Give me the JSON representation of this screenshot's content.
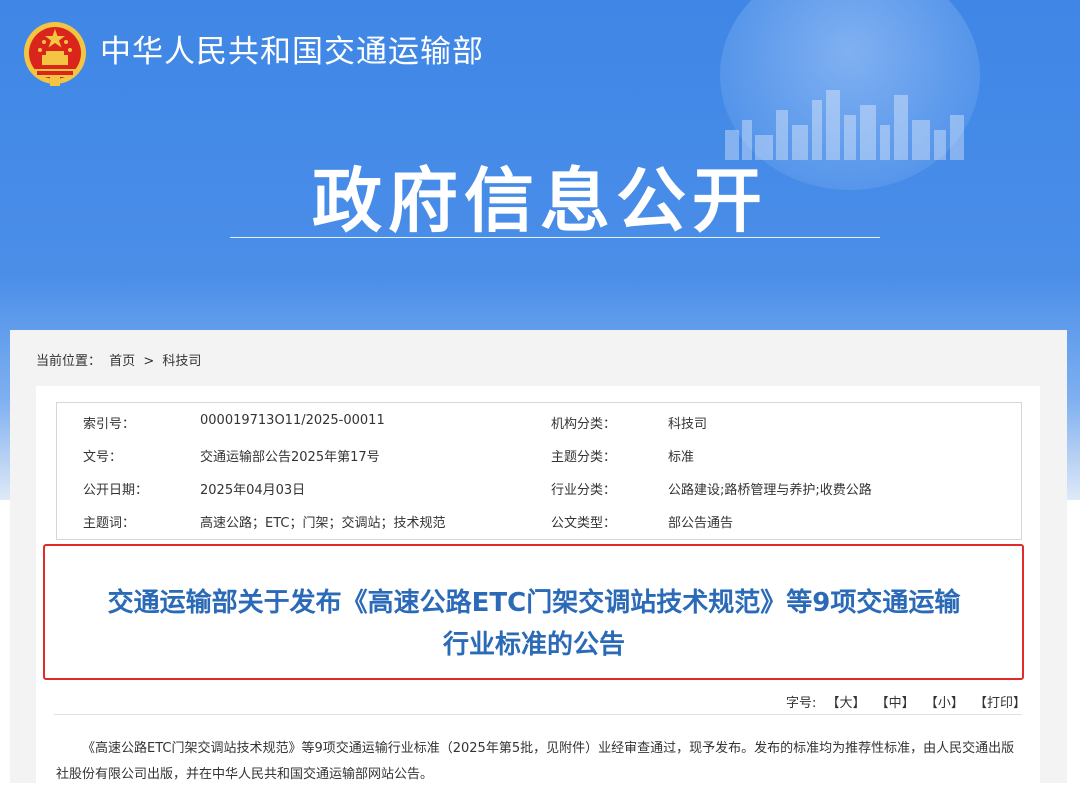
{
  "header": {
    "site_name": "中华人民共和国交通运输部",
    "hero_title": "政府信息公开"
  },
  "breadcrumb": {
    "label": "当前位置：",
    "home": "首页",
    "separator": ">",
    "current": "科技司"
  },
  "meta": {
    "rows": [
      {
        "k1": "索引号：",
        "v1": "000019713O11/2025-00011",
        "k2": "机构分类：",
        "v2": "科技司"
      },
      {
        "k1": "文号：",
        "v1": "交通运输部公告2025年第17号",
        "k2": "主题分类：",
        "v2": "标准"
      },
      {
        "k1": "公开日期：",
        "v1": "2025年04月03日",
        "k2": "行业分类：",
        "v2": "公路建设;路桥管理与养护;收费公路"
      },
      {
        "k1": "主题词：",
        "v1": "高速公路；ETC；门架；交调站；技术规范",
        "k2": "公文类型：",
        "v2": "部公告通告"
      }
    ]
  },
  "article": {
    "title_line1": "交通运输部关于发布《高速公路ETC门架交调站技术规范》等9项交通运输",
    "title_line2": "行业标准的公告",
    "font_size_label": "字号:",
    "font_large": "【大】",
    "font_medium": "【中】",
    "font_small": "【小】",
    "print": "【打印】",
    "body": "《高速公路ETC门架交调站技术规范》等9项交通运输行业标准（2025年第5批，见附件）业经审查通过，现予发布。发布的标准均为推荐性标准，由人民交通出版社股份有限公司出版，并在中华人民共和国交通运输部网站公告。"
  },
  "colors": {
    "banner_blue": "#4a8ee8",
    "title_blue": "#2a6ab7",
    "highlight_red": "#e02b2b"
  }
}
